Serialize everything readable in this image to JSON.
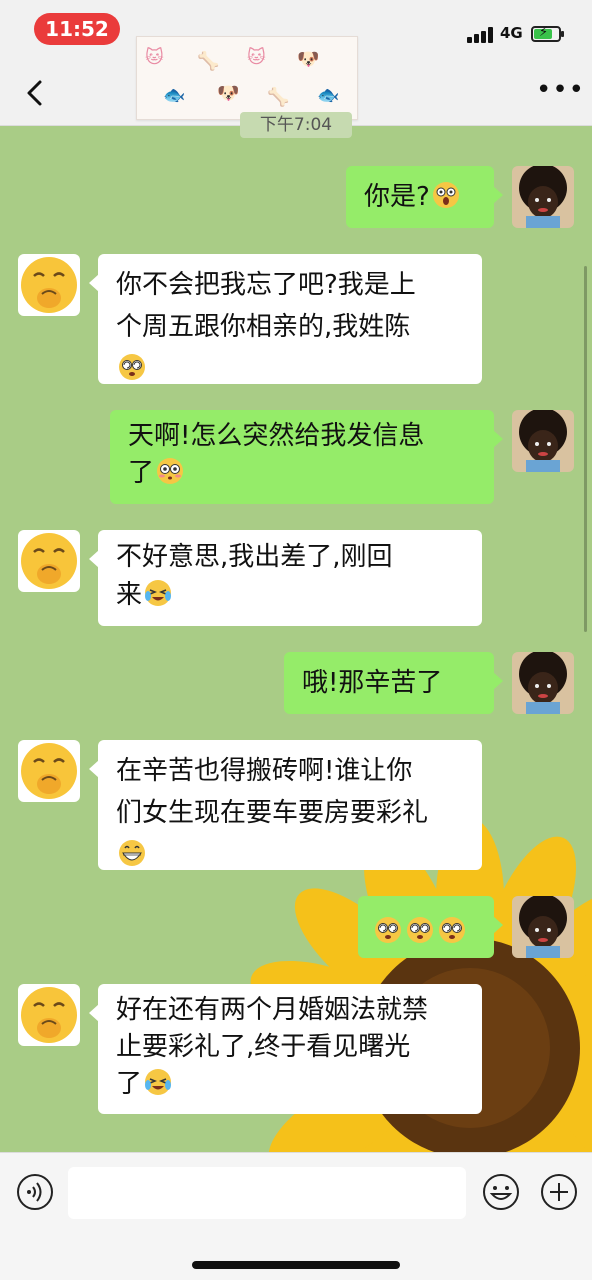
{
  "status_bar": {
    "time": "11:52",
    "network": "4G",
    "battery_level": 0.75,
    "battery_charging": true
  },
  "nav": {
    "back_icon": "chevron-left-icon",
    "more_icon": "more-dots-icon",
    "sticker_icons": [
      "cat-face",
      "dog-face",
      "bone",
      "fish"
    ]
  },
  "timestamp": "下午7:04",
  "messages": [
    {
      "from": "me",
      "text": "你是?",
      "emoji": "shocked-face"
    },
    {
      "from": "them",
      "lines": [
        "你不会把我忘了吧?我是上",
        "个周五跟你相亲的,我姓陈"
      ],
      "emoji": "dizzy-eyes-face"
    },
    {
      "from": "me",
      "lines": [
        "天啊!怎么突然给我发信息",
        "了"
      ],
      "emoji": "flushed-face"
    },
    {
      "from": "them",
      "lines": [
        "不好意思,我出差了,刚回",
        "来"
      ],
      "emoji": "crying-laughing-face"
    },
    {
      "from": "me",
      "text": "哦!那辛苦了"
    },
    {
      "from": "them",
      "lines": [
        "在辛苦也得搬砖啊!谁让你",
        "们女生现在要车要房要彩礼"
      ],
      "emoji": "grinning-face"
    },
    {
      "from": "me",
      "emojis": [
        "dizzy-eyes-face",
        "dizzy-eyes-face",
        "dizzy-eyes-face"
      ]
    },
    {
      "from": "them",
      "lines": [
        "好在还有两个月婚姻法就禁",
        "止要彩礼了,终于看见曙光",
        "了"
      ],
      "emoji": "crying-laughing-face"
    }
  ],
  "input_bar": {
    "voice_icon": "voice-icon",
    "emoji_icon": "smile-icon",
    "plus_icon": "plus-icon"
  },
  "colors": {
    "chat_bg": "#a9cc86",
    "outgoing_bubble": "#95ec69",
    "incoming_bubble": "#ffffff",
    "time_pill": "#ea3b3b"
  }
}
